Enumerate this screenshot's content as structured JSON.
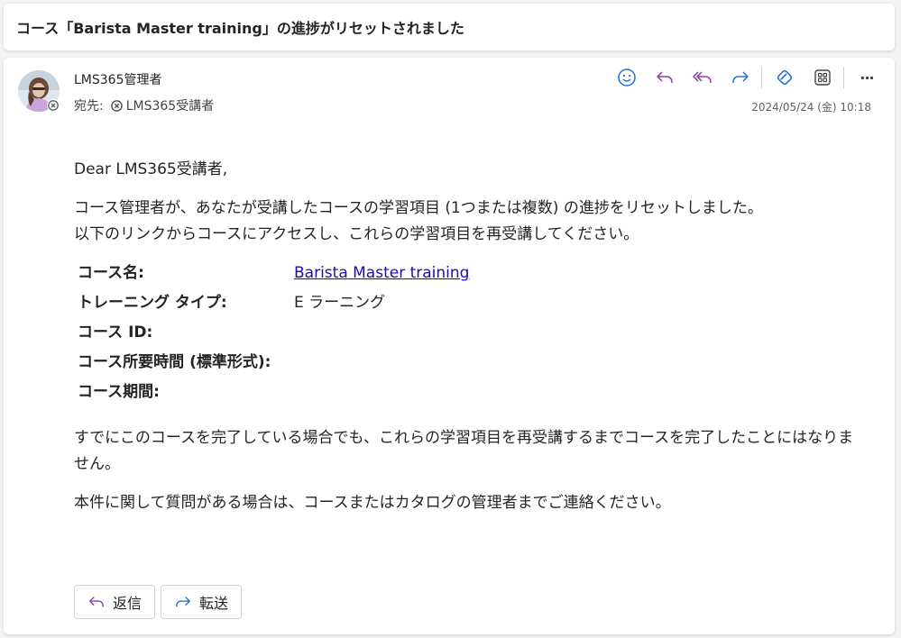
{
  "subject": "コース「Barista Master training」の進捗がリセットされました",
  "sender": {
    "name": "LMS365管理者",
    "to_label": "宛先:",
    "to_name": "LMS365受講者",
    "timestamp": "2024/05/24 (金) 10:18"
  },
  "toolbar": {
    "icons": [
      "emoji-icon",
      "reply-icon",
      "reply-all-icon",
      "forward-icon",
      "loop-icon",
      "apps-icon",
      "more-icon"
    ],
    "more_label": "···",
    "reply_color": "#8b3d9e",
    "forward_color": "#2b6fce"
  },
  "body": {
    "greeting": "Dear LMS365受講者,",
    "para1_line1": "コース管理者が、あなたが受講したコースの学習項目 (1つまたは複数) の進捗をリセットしました。",
    "para1_line2": "以下のリンクからコースにアクセスし、これらの学習項目を再受講してください。",
    "details": [
      {
        "label": "コース名:",
        "value": "Barista Master training",
        "link": true
      },
      {
        "label": "トレーニング タイプ:",
        "value": "E ラーニング",
        "link": false
      },
      {
        "label": "コース ID:",
        "value": "",
        "link": false
      },
      {
        "label": "コース所要時間 (標準形式):",
        "value": "",
        "link": false
      },
      {
        "label": "コース期間:",
        "value": "",
        "link": false
      }
    ],
    "para2": "すでにこのコースを完了している場合でも、これらの学習項目を再受講するまでコースを完了したことにはなりません。",
    "para3": "本件に関して質問がある場合は、コースまたはカタログの管理者までご連絡ください。"
  },
  "footer": {
    "reply_label": "返信",
    "forward_label": "転送"
  }
}
